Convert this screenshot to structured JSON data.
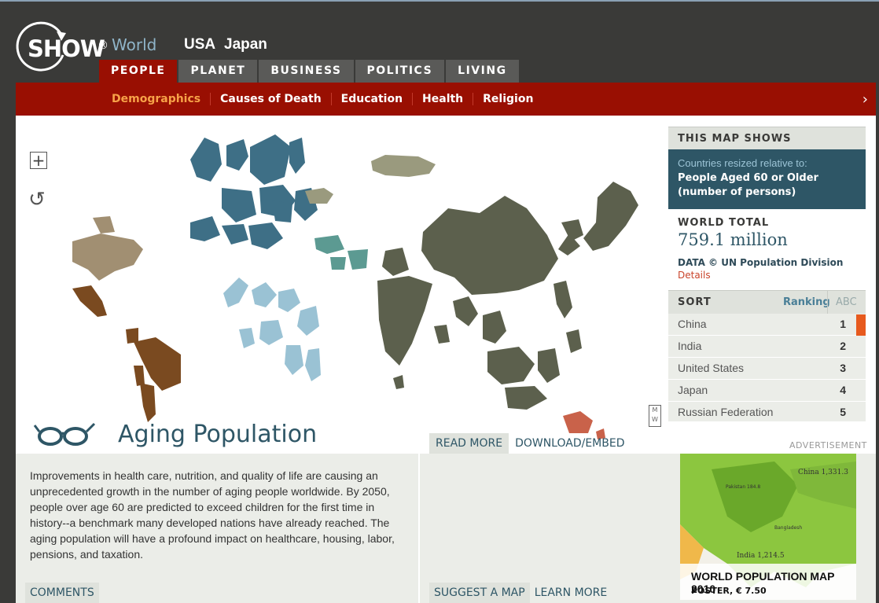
{
  "logo": {
    "show": "SHOW",
    "reg": "®",
    "world": "World"
  },
  "countries": [
    "USA",
    "Japan"
  ],
  "tabs": [
    "PEOPLE",
    "PLANET",
    "BUSINESS",
    "POLITICS",
    "LIVING"
  ],
  "subnav": [
    "Demographics",
    "Causes of Death",
    "Education",
    "Health",
    "Religion"
  ],
  "map_shows": {
    "header": "THIS MAP SHOWS",
    "label": "Countries resized relative to:",
    "value_line1": "People Aged 60 or Older",
    "value_line2": "(number of persons)"
  },
  "world_total": {
    "label": "WORLD TOTAL",
    "value": "759.1 million",
    "data": "DATA © UN Population Division",
    "details": "Details"
  },
  "sort": {
    "label": "SORT",
    "ranking": "Ranking",
    "abc": "ABC"
  },
  "ranking": [
    {
      "name": "China",
      "rank": "1"
    },
    {
      "name": "India",
      "rank": "2"
    },
    {
      "name": "United States",
      "rank": "3"
    },
    {
      "name": "Japan",
      "rank": "4"
    },
    {
      "name": "Russian Federation",
      "rank": "5"
    }
  ],
  "title": "Aging Population",
  "actions": {
    "read_more": "READ MORE",
    "download": "DOWNLOAD/EMBED"
  },
  "ad_label": "ADVERTISEMENT",
  "description": "Improvements in health care, nutrition, and quality of life are causing an unprecedented growth in the number of aging people worldwide. By 2050, people over age 60 are predicted to exceed children for the first time in history--a benchmark many developed nations have already reached. The aging population will have a profound impact on healthcare, housing, labor, pensions, and taxation.",
  "comments": "COMMENTS",
  "bottom_links": {
    "suggest": "SUGGEST A MAP",
    "learn": "LEARN MORE"
  },
  "ad": {
    "title": "WORLD POPULATION MAP 2010",
    "price": "POSTER, € 7.50",
    "map_labels": {
      "china": "China 1,331.3",
      "india": "India 1,214.5",
      "pakistan": "Pakistan 184.8",
      "bangladesh": "Bangladesh"
    }
  },
  "icons": [
    "plus-icon",
    "reset-icon",
    "glasses-icon",
    "chevron-right-icon"
  ],
  "colors": {
    "accent_red": "#990f02",
    "active_orange": "#f7a248",
    "teal": "#2e5666",
    "scroll_orange": "#e75a1e"
  }
}
